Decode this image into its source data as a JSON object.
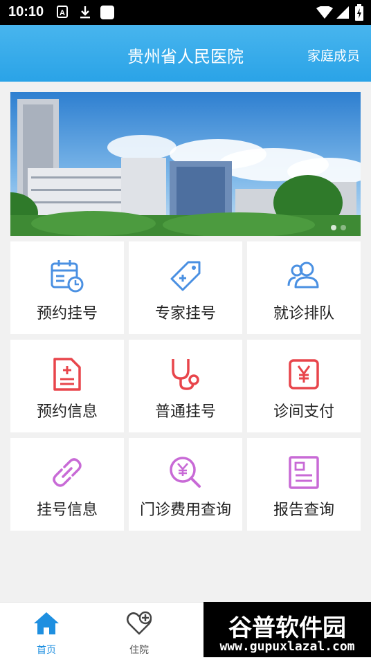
{
  "status_bar": {
    "time": "10:10"
  },
  "header": {
    "title": "贵州省人民医院",
    "family_label": "家庭成员"
  },
  "menu": [
    {
      "label": "预约挂号",
      "icon": "calendar-clock-icon",
      "color": "#4a90e2"
    },
    {
      "label": "专家挂号",
      "icon": "tag-icon",
      "color": "#4a90e2"
    },
    {
      "label": "就诊排队",
      "icon": "people-icon",
      "color": "#4a90e2"
    },
    {
      "label": "预约信息",
      "icon": "document-plus-icon",
      "color": "#e8454b"
    },
    {
      "label": "普通挂号",
      "icon": "stethoscope-icon",
      "color": "#e8454b"
    },
    {
      "label": "诊间支付",
      "icon": "yuan-icon",
      "color": "#e8454b"
    },
    {
      "label": "挂号信息",
      "icon": "link-icon",
      "color": "#c86ad6"
    },
    {
      "label": "门诊费用查询",
      "icon": "yuan-search-icon",
      "color": "#c86ad6"
    },
    {
      "label": "报告查询",
      "icon": "report-icon",
      "color": "#c86ad6"
    }
  ],
  "tabs": [
    {
      "label": "首页",
      "icon": "home-icon",
      "active": true,
      "color": "#1e8fe0"
    },
    {
      "label": "住院",
      "icon": "heart-plus-icon",
      "active": false,
      "color": "#555555"
    }
  ],
  "watermark": {
    "logo": "谷普软件园",
    "url": "www.gupuxlazal.com"
  }
}
